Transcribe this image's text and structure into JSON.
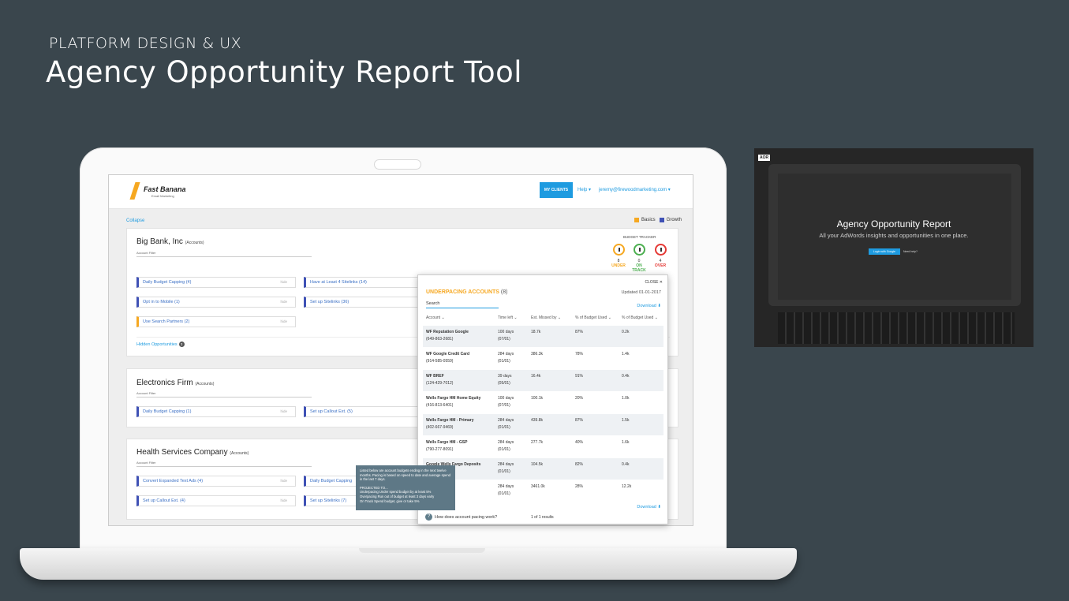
{
  "header": {
    "subtitle": "PLATFORM DESIGN & UX",
    "title": "Agency Opportunity Report Tool"
  },
  "app": {
    "logo_name": "Fast Banana",
    "logo_tag": "Email Marketing",
    "nav": {
      "my_clients": "MY CLIENTS",
      "help": "Help ▾",
      "email": "jeremy@firewoodmarketing.com ▾"
    },
    "collapse": "Collapse",
    "legend": [
      {
        "label": "Basics",
        "color": "#f6a821"
      },
      {
        "label": "Growth",
        "color": "#3f51b5"
      }
    ],
    "cards": [
      {
        "name": "Big Bank, Inc",
        "tag": "(Accounts)",
        "filter": "Account Filter",
        "opps": [
          "Daily Budget Capping (4)",
          "Have at Least 4 Sitelinks (14)",
          "Opt in to Mobile (1)",
          "Set up Sitelinks (36)",
          "Use Search Partners (2)"
        ],
        "hide": "hide",
        "hidden_label": "Hidden Opportunities",
        "hidden_count": "3"
      },
      {
        "name": "Electronics Firm",
        "tag": "(Accounts)",
        "filter": "Account Filter",
        "opps": [
          "Daily Budget Capping (1)",
          "Set up Callout Ext. (5)"
        ]
      },
      {
        "name": "Health Services Company",
        "tag": "(Accounts)",
        "filter": "Account Filter",
        "opps": [
          "Convert Expanded Text Ads (4)",
          "Daily Budget Capping",
          "Set up Callout Ext. (4)",
          "Set up Sitelinks (7)"
        ]
      }
    ],
    "budget_tracker": {
      "label": "BUDGET TRACKER",
      "items": [
        {
          "count": "8",
          "label": "UNDER",
          "color": "#f6a821"
        },
        {
          "count": "0",
          "label": "ON TRACK",
          "color": "#4caf50"
        },
        {
          "count": "4",
          "label": "OVER",
          "color": "#e53935"
        }
      ]
    },
    "panel": {
      "close": "CLOSE ✕",
      "title": "UNDERPACING ACCOUNTS",
      "count": "(8)",
      "updated": "Updated 01-01-2017",
      "search": "Search",
      "download": "Download ⬇",
      "columns": [
        "Account ⌄",
        "Time left ⌄",
        "Est. Missed by ⌄",
        "% of Budget Used ⌄",
        "% of Budget Used ⌄"
      ],
      "rows": [
        [
          "WF Reputation Google",
          "(649-863-2681)",
          "100 days",
          "(07/01)",
          "18.7k",
          "87%",
          "0.2k"
        ],
        [
          "WF Google Credit Card",
          "(914-585-0559)",
          "284 days",
          "(01/01)",
          "386.3k",
          "78%",
          "1.4k"
        ],
        [
          "WF BREF",
          "(124-429-7012)",
          "39 days",
          "(05/01)",
          "16.4k",
          "91%",
          "0.4k"
        ],
        [
          "Wells Fargo HM Home Equity",
          "(416-813-6401)",
          "100 days",
          "(07/01)",
          "100.1k",
          "20%",
          "1.0k"
        ],
        [
          "Wells Fargo HM - Primary",
          "(402-667-9469)",
          "284 days",
          "(01/01)",
          "439.8k",
          "87%",
          "1.5k"
        ],
        [
          "Wells Fargo HM - GSP",
          "(790-277-8091)",
          "284 days",
          "(01/01)",
          "277.7k",
          "40%",
          "1.6k"
        ],
        [
          "Google Wells Fargo Deposits",
          "",
          "284 days",
          "(01/01)",
          "104.5k",
          "82%",
          "0.4k"
        ],
        [
          "",
          "",
          "284 days",
          "(01/01)",
          "3461.0k",
          "28%",
          "12.2k"
        ]
      ],
      "help_q": "How does account pacing work?",
      "results": "1 of 1 results"
    },
    "tooltip": [
      "Listed below are account budgets ending in the next twelve months. Pacing is based on speed to date and average spend in the last 7 days.",
      "PROJECTED TO...",
      "Underpacing  Under spend budget by at least 5%",
      "Overpacing      Run out of budget at least 3 days early",
      "On Track           Spend budget, give or take 5%"
    ]
  },
  "thumbnail": {
    "logo": "AOR",
    "title": "Agency Opportunity Report",
    "subtitle": "All your AdWords insights and opportunities in one place.",
    "login": "Login with Google",
    "help": "Need help?"
  }
}
